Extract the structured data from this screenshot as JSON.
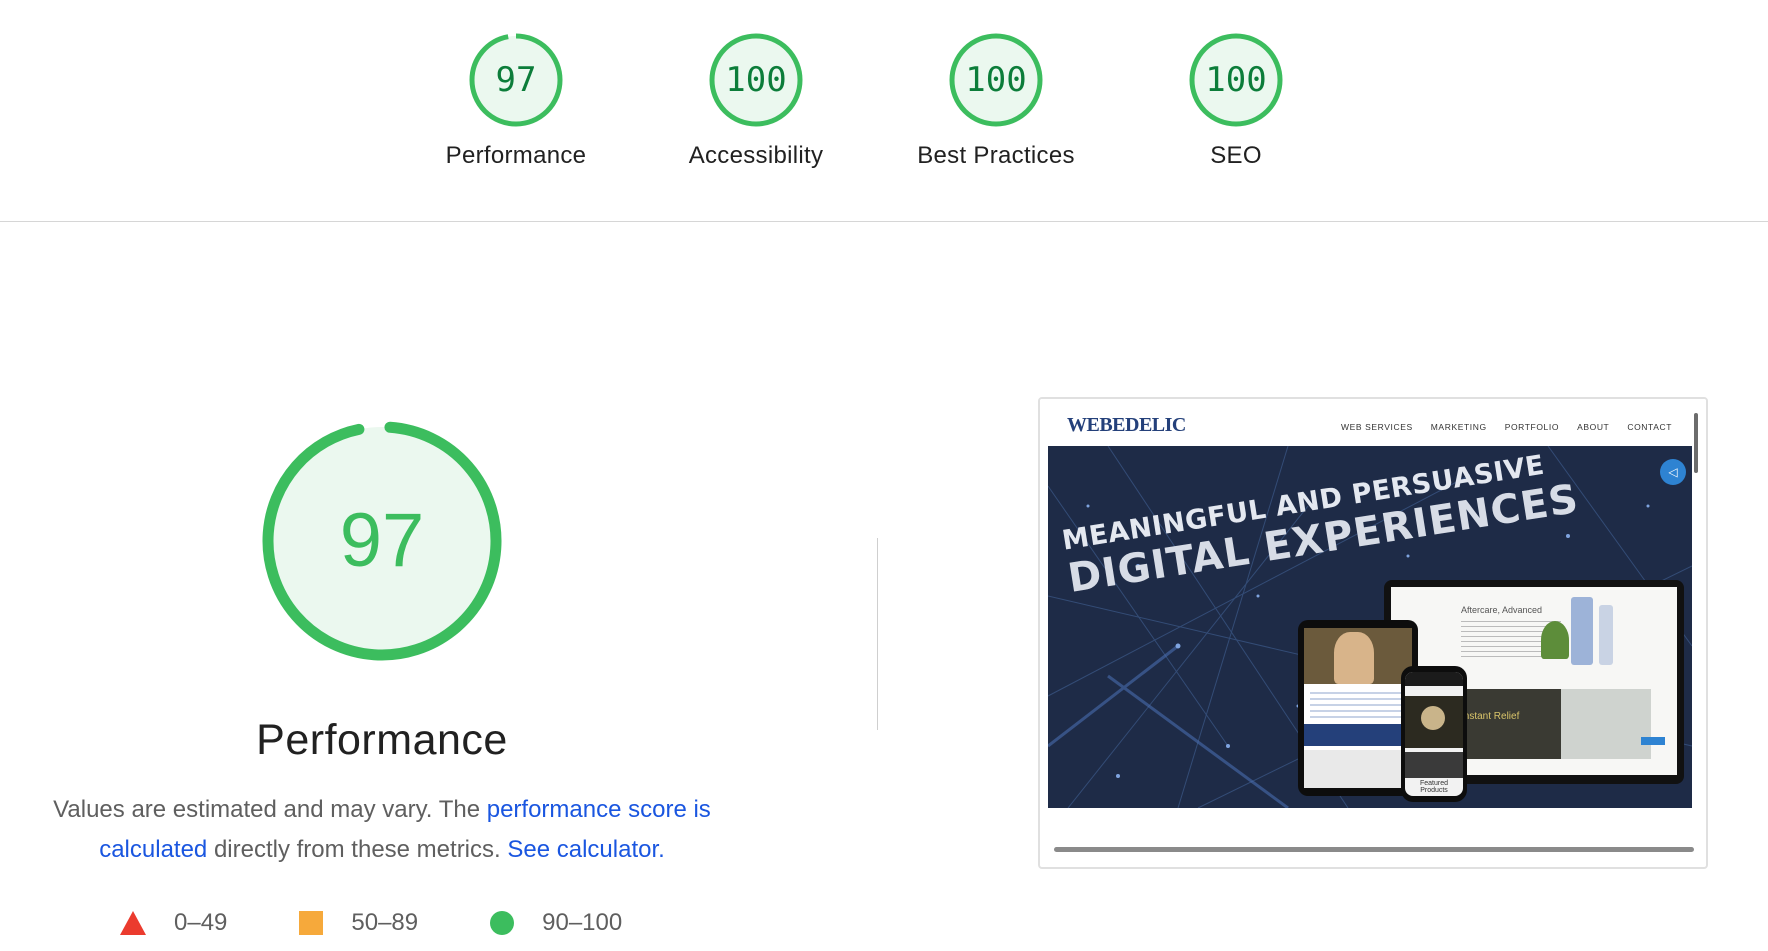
{
  "summary": {
    "gauges": [
      {
        "score": "97",
        "label": "Performance",
        "value": 0.97
      },
      {
        "score": "100",
        "label": "Accessibility",
        "value": 1.0
      },
      {
        "score": "100",
        "label": "Best Practices",
        "value": 1.0
      },
      {
        "score": "100",
        "label": "SEO",
        "value": 1.0
      }
    ]
  },
  "main": {
    "score": "97",
    "score_value": 0.97,
    "title": "Performance",
    "desc_prefix": "Values are estimated and may vary. The ",
    "desc_link": "performance score is calculated",
    "desc_middle": " directly from these metrics. ",
    "desc_calc_link": "See calculator."
  },
  "legend": {
    "fail": "0–49",
    "average": "50–89",
    "pass": "90–100"
  },
  "colors": {
    "pass": "#3cbd5e",
    "pass_text": "#0c7d3a",
    "average": "#f6a93b",
    "fail": "#eb3b2e",
    "link": "#1a56e0"
  },
  "preview": {
    "logo": "WEBEDELIC",
    "menu": [
      "WEB SERVICES",
      "MARKETING",
      "PORTFOLIO",
      "ABOUT",
      "CONTACT"
    ],
    "hero_line1": "MEANINGFUL AND PERSUASIVE",
    "hero_line2": "DIGITAL EXPERIENCES",
    "laptop_heading": "Aftercare, Advanced",
    "laptop_subheading": "Instant Relief",
    "phone_label": "Featured Products"
  }
}
